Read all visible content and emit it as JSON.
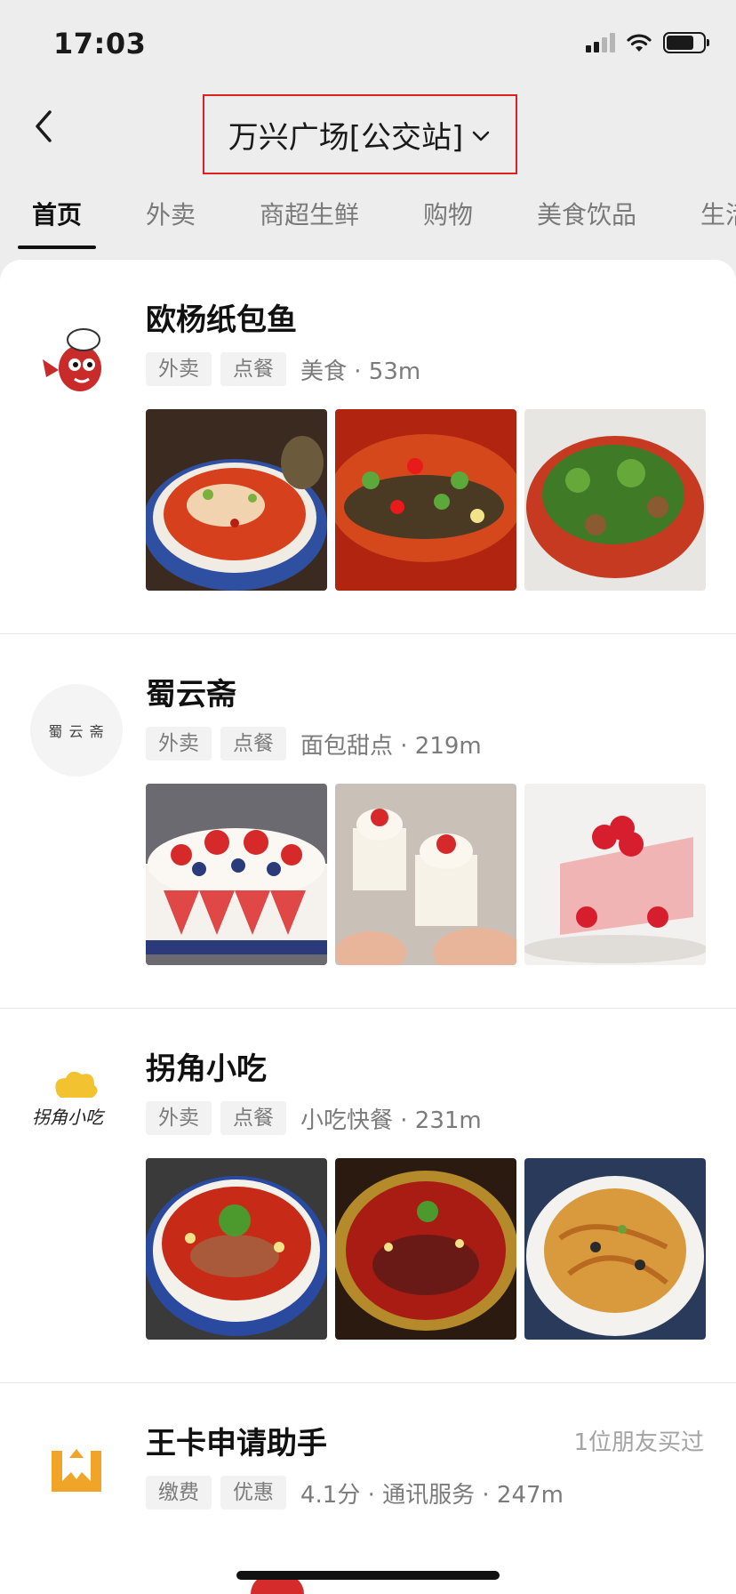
{
  "status": {
    "time": "17:03"
  },
  "header": {
    "location": "万兴广场[公交站]"
  },
  "tabs": [
    {
      "label": "首页",
      "active": true
    },
    {
      "label": "外卖"
    },
    {
      "label": "商超生鲜"
    },
    {
      "label": "购物"
    },
    {
      "label": "美食饮品"
    },
    {
      "label": "生活"
    }
  ],
  "shops": [
    {
      "name": "欧杨纸包鱼",
      "tags": [
        "外卖",
        "点餐"
      ],
      "meta": "美食 · 53m"
    },
    {
      "name": "蜀云斋",
      "logo_text": "蜀 云 斋",
      "tags": [
        "外卖",
        "点餐"
      ],
      "meta": "面包甜点 · 219m"
    },
    {
      "name": "拐角小吃",
      "logo_text": "拐角小吃",
      "tags": [
        "外卖",
        "点餐"
      ],
      "meta": "小吃快餐 · 231m"
    },
    {
      "name": "王卡申请助手",
      "tags": [
        "缴费",
        "优惠"
      ],
      "meta": "4.1分 · 通讯服务 · 247m",
      "friend_note": "1位朋友买过"
    }
  ],
  "colors": {
    "accent_red": "#e02020",
    "background": "#ededed",
    "card": "#ffffff",
    "tag_bg": "#f2f2f2"
  }
}
